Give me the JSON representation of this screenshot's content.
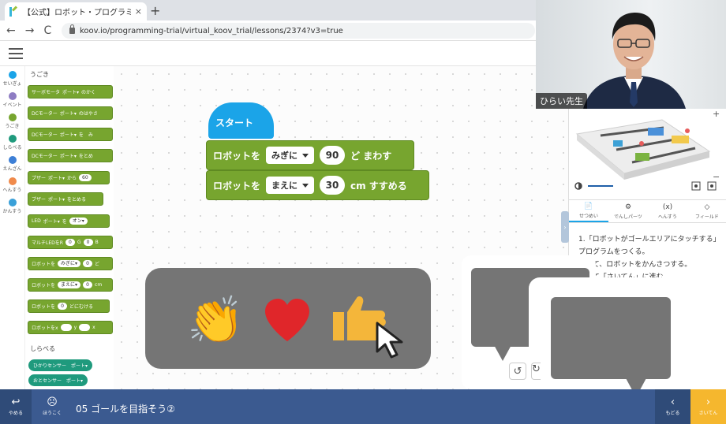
{
  "browser": {
    "tab_title": "【公式】ロボット・プログラミング学習キ",
    "tab_close": "×",
    "new_tab": "+",
    "back": "←",
    "forward": "→",
    "reload": "C",
    "url": "koov.io/programming-trial/virtual_koov_trial/lessons/2374?v3=true"
  },
  "categories": [
    {
      "label": "せいぎょ",
      "color": "#1ba4e8"
    },
    {
      "label": "イベント",
      "color": "#8e7cc3"
    },
    {
      "label": "うごき",
      "color": "#77a52f"
    },
    {
      "label": "しらべる",
      "color": "#1f9a7d"
    },
    {
      "label": "えんざん",
      "color": "#3d7fd6"
    },
    {
      "label": "へんすう",
      "color": "#f08a4b"
    },
    {
      "label": "かんすう",
      "color": "#3aa0d8"
    }
  ],
  "palette": {
    "section_title": "うごき",
    "blocks": [
      {
        "text": "サーボモータ",
        "p1": "ポート▾",
        "text2": "のかく"
      },
      {
        "text": "DCモーター",
        "p1": "ポート▾",
        "text2": "のはやさ"
      },
      {
        "text": "DCモーター",
        "p1": "ポート▾",
        "text2": "を　み"
      },
      {
        "text": "DCモーター",
        "p1": "ポート▾",
        "text2": "をとめ"
      },
      {
        "text": "ブザー",
        "p1": "ポート▾",
        "text2": "から",
        "p2": "60"
      },
      {
        "text": "ブザー",
        "p1": "ポート▾",
        "text2": "をとめる"
      },
      {
        "text": "LED",
        "p1": "ポート▾",
        "text2": "を",
        "p2": "オン▾"
      },
      {
        "text": "マルチLEDをR",
        "p1": "0",
        "text2": "G",
        "p2": "0",
        "text3": "B"
      },
      {
        "text": "ロボットを",
        "p1": "みぎに▾",
        "p2": "0",
        "text2": "ど"
      },
      {
        "text": "ロボットを",
        "p1": "まえに▾",
        "p2": "0",
        "text2": "cm"
      },
      {
        "text": "ロボットを",
        "p1": "0",
        "text2": "どにむける"
      },
      {
        "text": "ロボットをx",
        "p1": "　",
        "text2": "y",
        "p2": "　",
        "text3": "x"
      }
    ],
    "section2_title": "しらべる",
    "sensors": [
      {
        "text": "ひかりセンサー　ポート▾"
      },
      {
        "text": "おとセンサー　ポート▾"
      }
    ]
  },
  "workspace": {
    "start_label": "スタート",
    "block1": {
      "prefix": "ロボットを",
      "dropdown": "みぎに",
      "value": "90",
      "suffix": "ど まわす"
    },
    "block2": {
      "prefix": "ロボットを",
      "dropdown": "まえに",
      "value": "30",
      "suffix": "cm すすめる"
    }
  },
  "reactions": {
    "clap": "👏",
    "heart": "heart",
    "thumb": "thumbs-up"
  },
  "webcam": {
    "name": "ひらい先生"
  },
  "right_panel": {
    "zoom_plus": "+",
    "zoom_minus": "−",
    "tabs": [
      {
        "label": "せつめい",
        "icon": "📄"
      },
      {
        "label": "でんしパーツ",
        "icon": "⚙"
      },
      {
        "label": "へんすう",
        "icon": "(x)"
      },
      {
        "label": "フィールド",
        "icon": "◇"
      }
    ],
    "instructions": [
      "1.「ロボットがゴールエリアにタッチする」",
      "プログラムをつくる。",
      "らして、ロボットをかんさつする。",
      "らして「さいてん」に進む。"
    ],
    "collapse": "›"
  },
  "toolbar": {
    "undo": "↺",
    "redo": "↻"
  },
  "bottom": {
    "quit_icon": "↩",
    "quit_label": "やめる",
    "report_icon": "☹",
    "report_label": "ほうこく",
    "lesson_title": "05 ゴールを目指そう②",
    "back_icon": "‹",
    "back_label": "もどる",
    "next_icon": "›",
    "next_label": "さいてん"
  },
  "colors": {
    "start": "#1ba4e8",
    "motion": "#77a52f",
    "bottom_bar": "#3b5a90",
    "next": "#f5b72e",
    "overlay": "#757575"
  }
}
